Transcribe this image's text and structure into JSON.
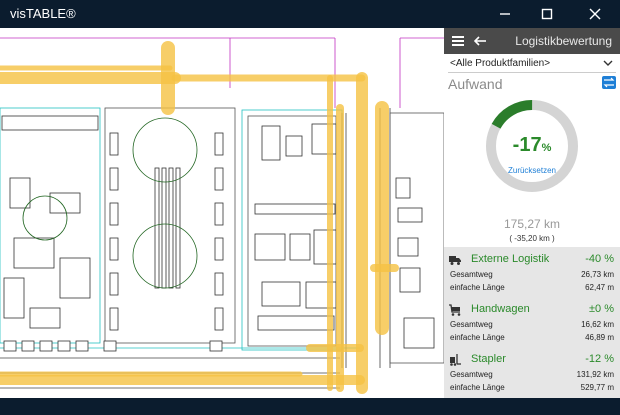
{
  "window": {
    "title": "visTABLE®"
  },
  "panel": {
    "title": "Logistikbewertung",
    "dropdown": "<Alle Produktfamilien>",
    "section": "Aufwand",
    "gauge": {
      "percent": "-17",
      "unit": "%",
      "reset_label": "Zurücksetzen",
      "fill_fraction": 0.17
    },
    "total_km": "175,27 km",
    "delta_km": "( -35,20 km )",
    "categories": [
      {
        "name": "Externe Logistik",
        "percent": "-40 %",
        "gesamtweg_label": "Gesamtweg",
        "gesamtweg": "26,73 km",
        "laenge_label": "einfache Länge",
        "laenge": "62,47 m",
        "icon": "truck-icon"
      },
      {
        "name": "Handwagen",
        "percent": "±0 %",
        "gesamtweg_label": "Gesamtweg",
        "gesamtweg": "16,62 km",
        "laenge_label": "einfache Länge",
        "laenge": "46,89 m",
        "icon": "handcart-icon"
      },
      {
        "name": "Stapler",
        "percent": "-12 %",
        "gesamtweg_label": "Gesamtweg",
        "gesamtweg": "131,92 km",
        "laenge_label": "einfache Länge",
        "laenge": "529,77 m",
        "icon": "forklift-icon"
      }
    ]
  },
  "colors": {
    "accent": "#1e7fd6",
    "positive": "#2b8a2b",
    "flow": "#f5c242",
    "header": "#4a4a4a"
  }
}
